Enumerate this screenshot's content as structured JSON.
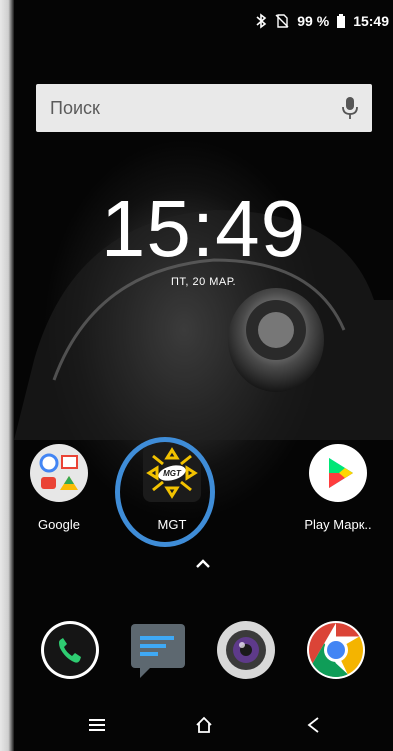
{
  "status_bar": {
    "battery": "99 %",
    "time": "15:49",
    "icons": [
      "bluetooth-icon",
      "no-sim-icon",
      "battery-icon"
    ]
  },
  "search": {
    "placeholder": "Поиск",
    "icon": "mic-icon"
  },
  "clock": {
    "time": "15:49",
    "date": "ПТ, 20 МАР."
  },
  "apps": [
    {
      "label": "Google",
      "icon": "google-folder-icon"
    },
    {
      "label": "MGT",
      "icon": "mgt-app-icon"
    },
    {
      "label": "Play Марк..",
      "icon": "play-store-icon"
    }
  ],
  "dock": [
    {
      "name": "phone",
      "icon": "phone-icon"
    },
    {
      "name": "messages",
      "icon": "messages-icon"
    },
    {
      "name": "camera",
      "icon": "camera-icon"
    },
    {
      "name": "chrome",
      "icon": "chrome-icon"
    }
  ],
  "nav_bar": [
    "menu-icon",
    "home-icon",
    "back-icon"
  ],
  "colors": {
    "highlight": "#3f8dd8",
    "search_bg": "#e9e9e9"
  }
}
